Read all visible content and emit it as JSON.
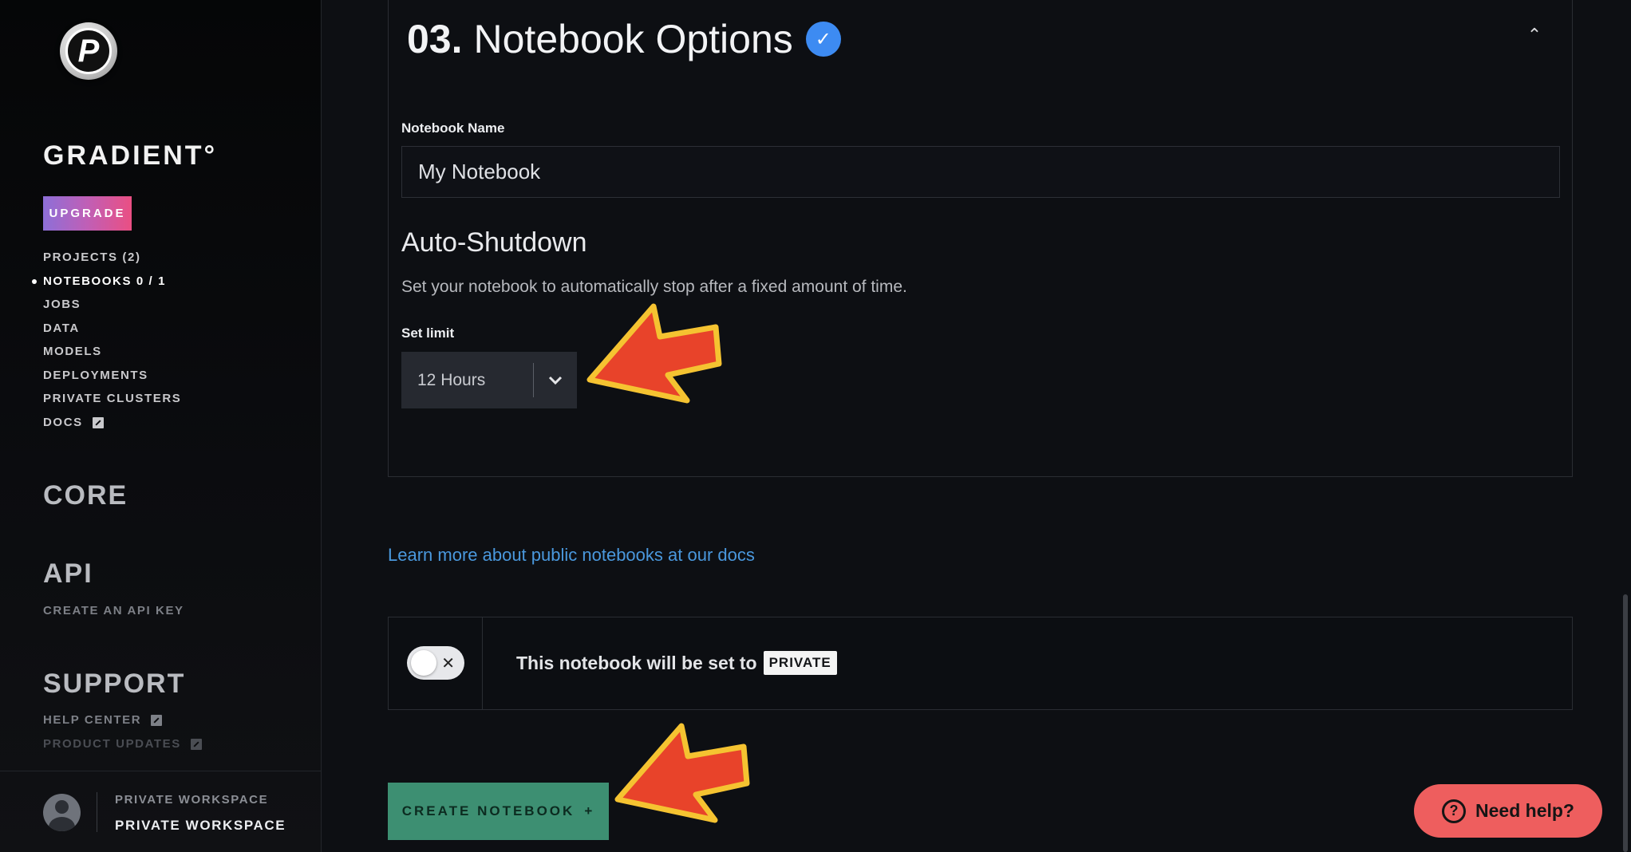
{
  "sidebar": {
    "logo_letter": "P",
    "brand": "GRADIENT°",
    "upgrade_label": "UPGRADE",
    "nav": [
      {
        "label": "PROJECTS (2)",
        "active": false,
        "external": false
      },
      {
        "label": "NOTEBOOKS 0 / 1",
        "active": true,
        "external": false
      },
      {
        "label": "JOBS",
        "active": false,
        "external": false
      },
      {
        "label": "DATA",
        "active": false,
        "external": false
      },
      {
        "label": "MODELS",
        "active": false,
        "external": false
      },
      {
        "label": "DEPLOYMENTS",
        "active": false,
        "external": false
      },
      {
        "label": "PRIVATE CLUSTERS",
        "active": false,
        "external": false
      },
      {
        "label": "DOCS",
        "active": false,
        "external": true
      }
    ],
    "core_heading": "CORE",
    "api_heading": "API",
    "api_link": "CREATE AN API KEY",
    "support_heading": "SUPPORT",
    "help_center": "HELP CENTER",
    "product_updates": "PRODUCT UPDATES",
    "workspace": {
      "label": "PRIVATE WORKSPACE",
      "name": "PRIVATE WORKSPACE"
    }
  },
  "section": {
    "number": "03.",
    "title": "Notebook Options",
    "collapse_icon": "chevron-up-icon"
  },
  "form": {
    "name_label": "Notebook Name",
    "name_value": "My Notebook",
    "auto_shutdown_heading": "Auto-Shutdown",
    "auto_shutdown_desc": "Set your notebook to automatically stop after a fixed amount of time.",
    "limit_label": "Set limit",
    "limit_value": "12 Hours"
  },
  "learn_more_link": "Learn more about public notebooks at our docs",
  "privacy": {
    "text": "This notebook will be set to",
    "badge": "PRIVATE"
  },
  "create_button": "CREATE NOTEBOOK",
  "create_button_icon": "+",
  "help_button": "Need help?",
  "colors": {
    "accent_green": "#3d8f72",
    "link_blue": "#4a98dd",
    "check_blue": "#3d8bf2",
    "help_red": "#ee5e5e",
    "annotation_arrow": "#e8432a"
  }
}
